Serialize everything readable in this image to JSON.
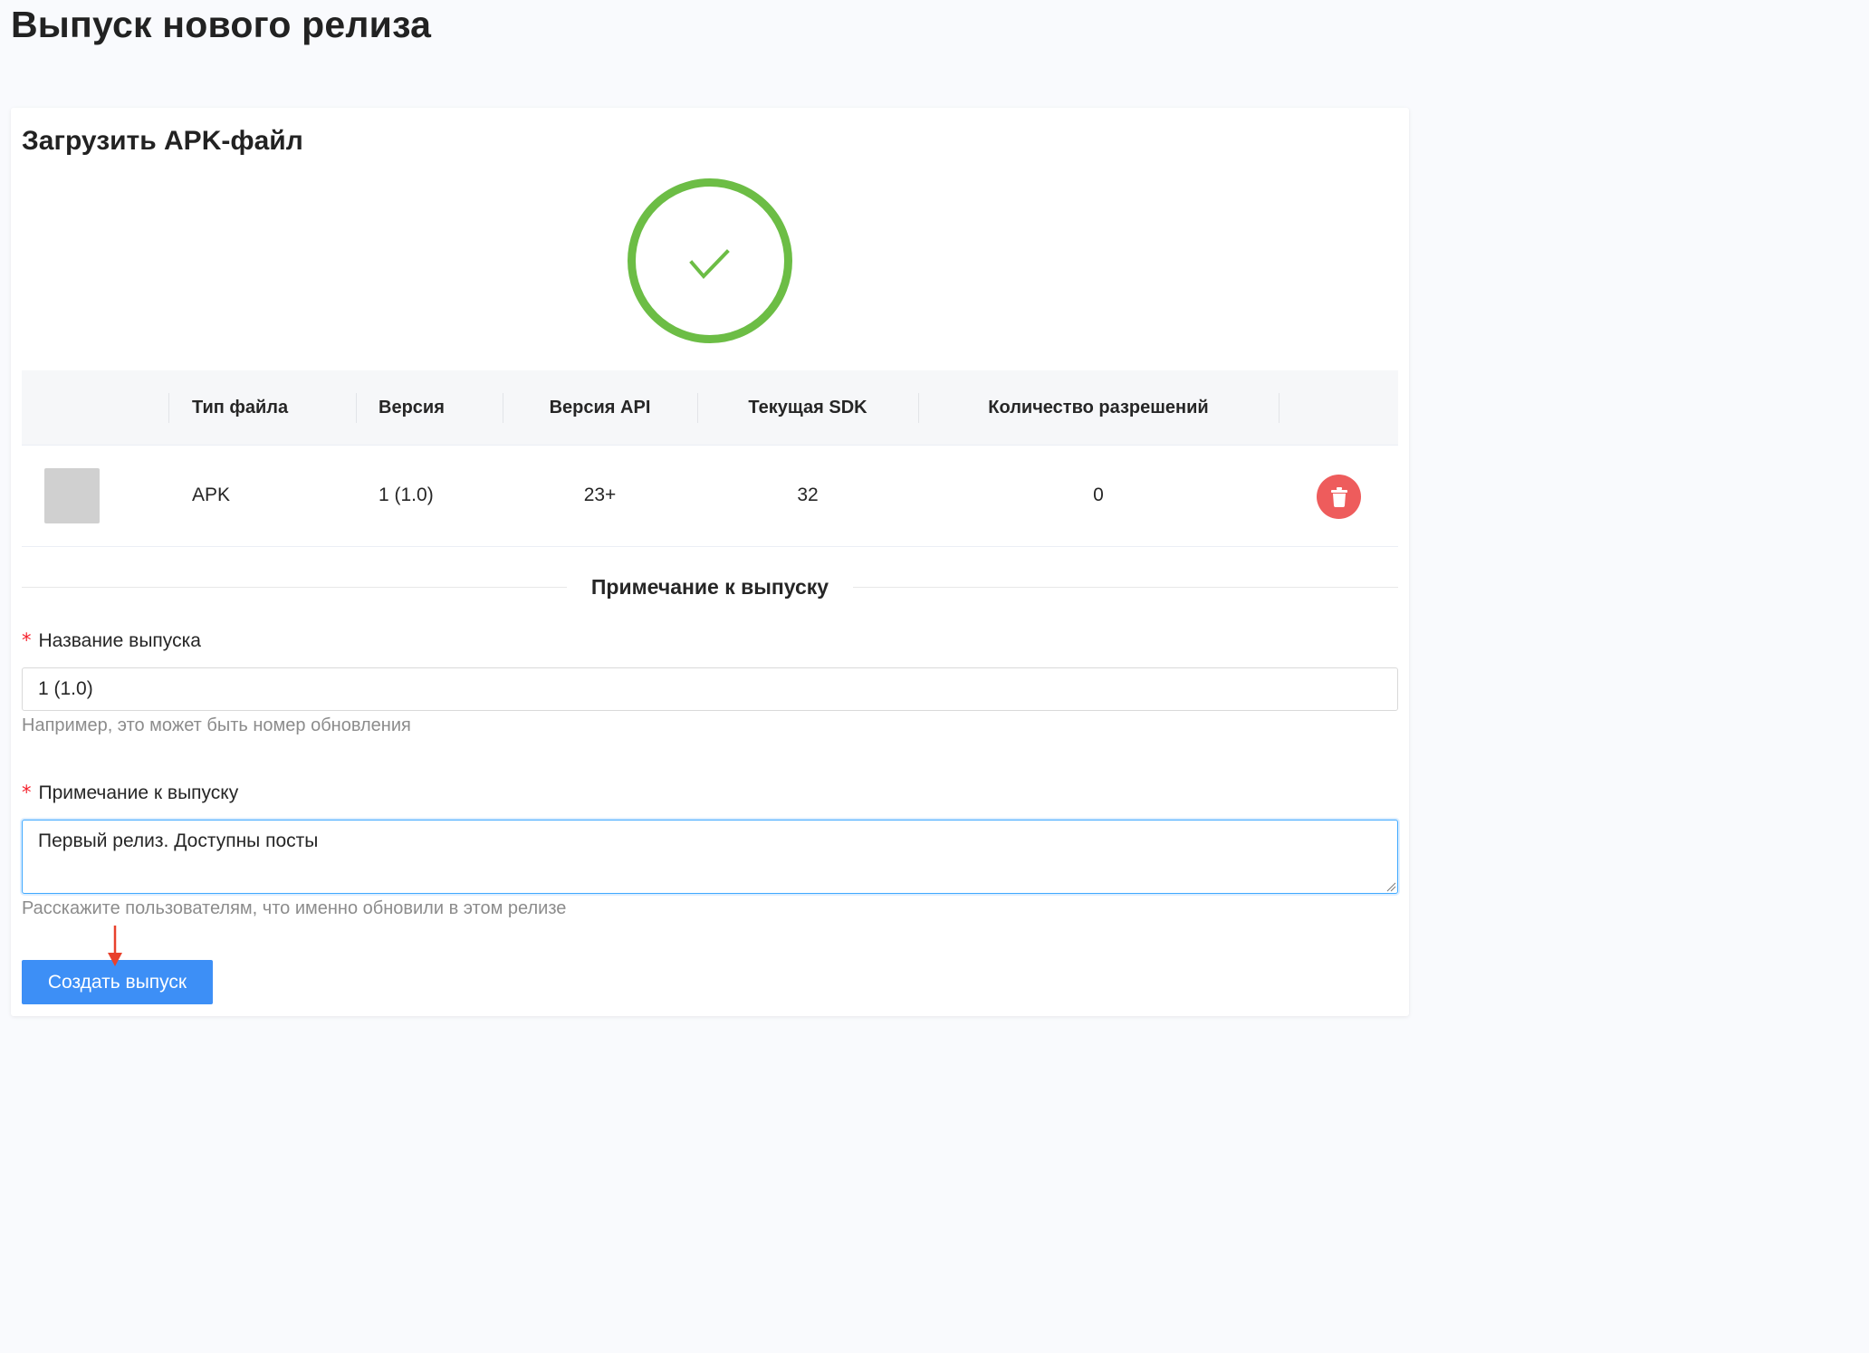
{
  "page": {
    "title": "Выпуск нового релиза"
  },
  "upload": {
    "title": "Загрузить APK-файл",
    "status_icon": "check-icon",
    "status_color": "#6cbd45"
  },
  "table": {
    "columns": [
      "",
      "Тип файла",
      "Версия",
      "Версия API",
      "Текущая SDK",
      "Количество разрешений",
      ""
    ],
    "rows": [
      {
        "file_type": "APK",
        "version": "1 (1.0)",
        "api_version": "23+",
        "target_sdk": "32",
        "permissions_count": "0",
        "delete_icon": "trash-icon"
      }
    ]
  },
  "release_notes_section": {
    "title": "Примечание к выпуску"
  },
  "form": {
    "release_name": {
      "label": "Название выпуска",
      "required_mark": "*",
      "value": "1 (1.0)",
      "hint": "Например, это может быть номер обновления"
    },
    "release_note": {
      "label": "Примечание к выпуску",
      "required_mark": "*",
      "value": "Первый релиз. Доступны посты",
      "hint": "Расскажите пользователям, что именно обновили в этом релизе"
    },
    "submit_label": "Создать выпуск"
  },
  "colors": {
    "primary": "#3d8ff6",
    "danger": "#ee5c5c",
    "success": "#6cbd45",
    "required": "#f5222d",
    "annotation": "#e8412c"
  }
}
